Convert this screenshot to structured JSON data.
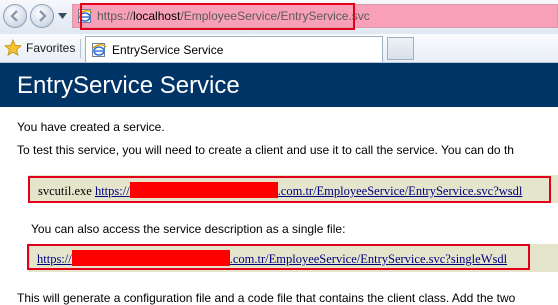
{
  "browser": {
    "address_url_prefix": "https://",
    "address_url_host": "localhost",
    "address_url_path": "/EmployeeService/EntryService.svc",
    "favorites_label": "Favorites",
    "tab_title": "EntryService Service",
    "icons": [
      "back-icon",
      "forward-icon",
      "recent-pages-icon",
      "ie-page-icon",
      "favorites-star-icon",
      "new-tab-icon"
    ],
    "colors": {
      "address_bar_bg": "#f8a0b8",
      "highlight": "#e3001b"
    }
  },
  "page": {
    "title": "EntryService Service",
    "intro": "You have created a service.",
    "test_text": "To test this service, you will need to create a client and use it to call the service. You can do th",
    "svcutil_cmd": "svcutil.exe",
    "wsdl_url_start": "https://",
    "wsdl_url_end": ".com.tr/EmployeeService/EntryService.svc?wsdl",
    "single_text": "You can also access the service description as a single file:",
    "single_url_start": "https://",
    "single_url_end": ".com.tr/EmployeeService/EntryService.svc?singleWsdl",
    "generate_text": "This will generate a configuration file and a code file that contains the client class. Add the two",
    "colors": {
      "header_band": "#003366",
      "code_box": "#e5e5cc",
      "link": "#000080",
      "redaction": "#ff0000"
    }
  }
}
